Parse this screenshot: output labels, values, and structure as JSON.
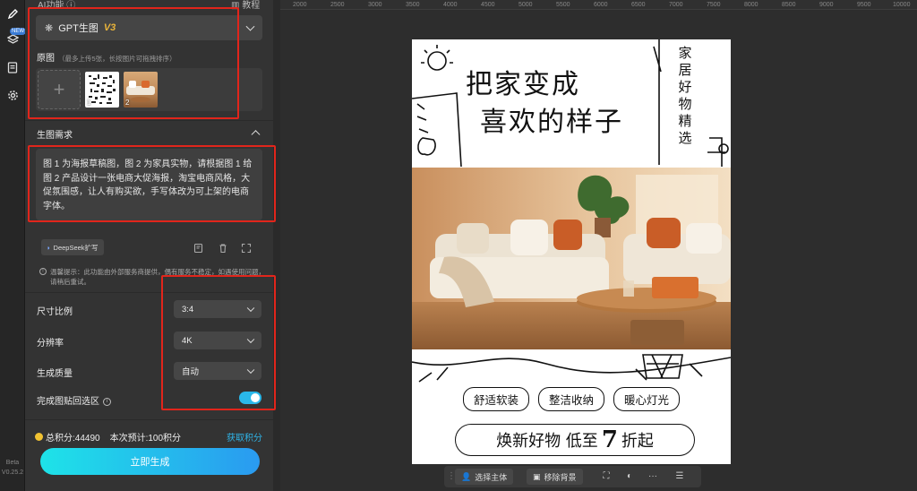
{
  "panel": {
    "title": "AI功能 ⓘ",
    "tutorial": "教程",
    "model": {
      "name": "GPT生图",
      "version": "V3"
    },
    "original": {
      "label": "原图",
      "hint": "（最多上传5张，长按图片可拖拽排序）",
      "thumbs": [
        "1",
        "2"
      ]
    },
    "requirement": {
      "label": "生图需求",
      "prompt": "图 1 为海报草稿图，图 2 为家具实物，请根据图 1 给图 2 产品设计一张电商大促海报，淘宝电商风格，大促氛围感，让人有购买欲，手写体改为可上架的电商字体。",
      "deepseek": "DeepSeek扩写"
    },
    "notice": "温馨提示：此功能由外部服务商提供，偶有服务不稳定，如遇使用问题，请稍后重试。",
    "settings": {
      "ratio": {
        "label": "尺寸比例",
        "value": "3:4"
      },
      "resolution": {
        "label": "分辨率",
        "value": "4K"
      },
      "quality": {
        "label": "生成质量",
        "value": "自动"
      },
      "paste": {
        "label": "完成图贴回选区",
        "on": true
      }
    },
    "points": {
      "total": "总积分:44490",
      "estimate": "本次预计:100积分",
      "get": "获取积分"
    },
    "generate": "立即生成"
  },
  "rail": {
    "badge": "NEW",
    "version": "Beta V0.25.2"
  },
  "ruler": {
    "ticks": [
      "2000",
      "2500",
      "3000",
      "3500",
      "4000",
      "4500",
      "5000",
      "5500",
      "6000",
      "6500",
      "7000",
      "7500",
      "8000",
      "8500",
      "9000",
      "9500",
      "10000"
    ]
  },
  "poster": {
    "headline1": "把家变成",
    "headline2": "喜欢的样子",
    "vertical": "家居好物精选",
    "tags": [
      "舒适软装",
      "整洁收纳",
      "暖心灯光"
    ],
    "slogan_pre": "焕新好物 低至",
    "slogan_num": "7",
    "slogan_post": "折起"
  },
  "toolbar": {
    "select_subject": "选择主体",
    "remove_bg": "移除背景",
    "more": "···"
  },
  "colors": {
    "accent": "#2ab8ea",
    "annotation": "#e1251b",
    "coin": "#f1c232"
  }
}
